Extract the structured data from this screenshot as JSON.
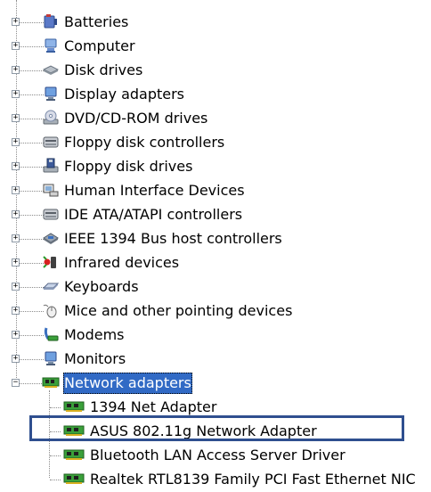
{
  "tree": {
    "categories": [
      {
        "label": "Batteries",
        "icon": "battery-icon",
        "expander": "+"
      },
      {
        "label": "Computer",
        "icon": "computer-icon",
        "expander": "+"
      },
      {
        "label": "Disk drives",
        "icon": "disk-drive-icon",
        "expander": "+"
      },
      {
        "label": "Display adapters",
        "icon": "display-adapter-icon",
        "expander": "+"
      },
      {
        "label": "DVD/CD-ROM drives",
        "icon": "cd-drive-icon",
        "expander": "+"
      },
      {
        "label": "Floppy disk controllers",
        "icon": "controller-icon",
        "expander": "+"
      },
      {
        "label": "Floppy disk drives",
        "icon": "floppy-drive-icon",
        "expander": "+"
      },
      {
        "label": "Human Interface Devices",
        "icon": "hid-icon",
        "expander": "+"
      },
      {
        "label": "IDE ATA/ATAPI controllers",
        "icon": "ide-controller-icon",
        "expander": "+"
      },
      {
        "label": "IEEE 1394 Bus host controllers",
        "icon": "ieee1394-icon",
        "expander": "+"
      },
      {
        "label": "Infrared devices",
        "icon": "infrared-icon",
        "expander": "+"
      },
      {
        "label": "Keyboards",
        "icon": "keyboard-icon",
        "expander": "+"
      },
      {
        "label": "Mice and other pointing devices",
        "icon": "mouse-icon",
        "expander": "+"
      },
      {
        "label": "Modems",
        "icon": "modem-icon",
        "expander": "+"
      },
      {
        "label": "Monitors",
        "icon": "monitor-icon",
        "expander": "+"
      },
      {
        "label": "Network adapters",
        "icon": "network-adapter-icon",
        "expander": "−",
        "selected": true
      }
    ],
    "network_children": [
      {
        "label": "1394 Net Adapter",
        "icon": "network-card-icon"
      },
      {
        "label": "ASUS 802.11g Network Adapter",
        "icon": "network-card-icon",
        "highlighted": true
      },
      {
        "label": "Bluetooth LAN Access Server Driver",
        "icon": "network-card-icon"
      },
      {
        "label": "Realtek RTL8139 Family PCI Fast Ethernet NIC",
        "icon": "network-card-icon"
      }
    ]
  },
  "colors": {
    "selection_bg": "#316ac5",
    "highlight_border": "#2f4f8f",
    "tree_line": "#8c8c8c"
  }
}
